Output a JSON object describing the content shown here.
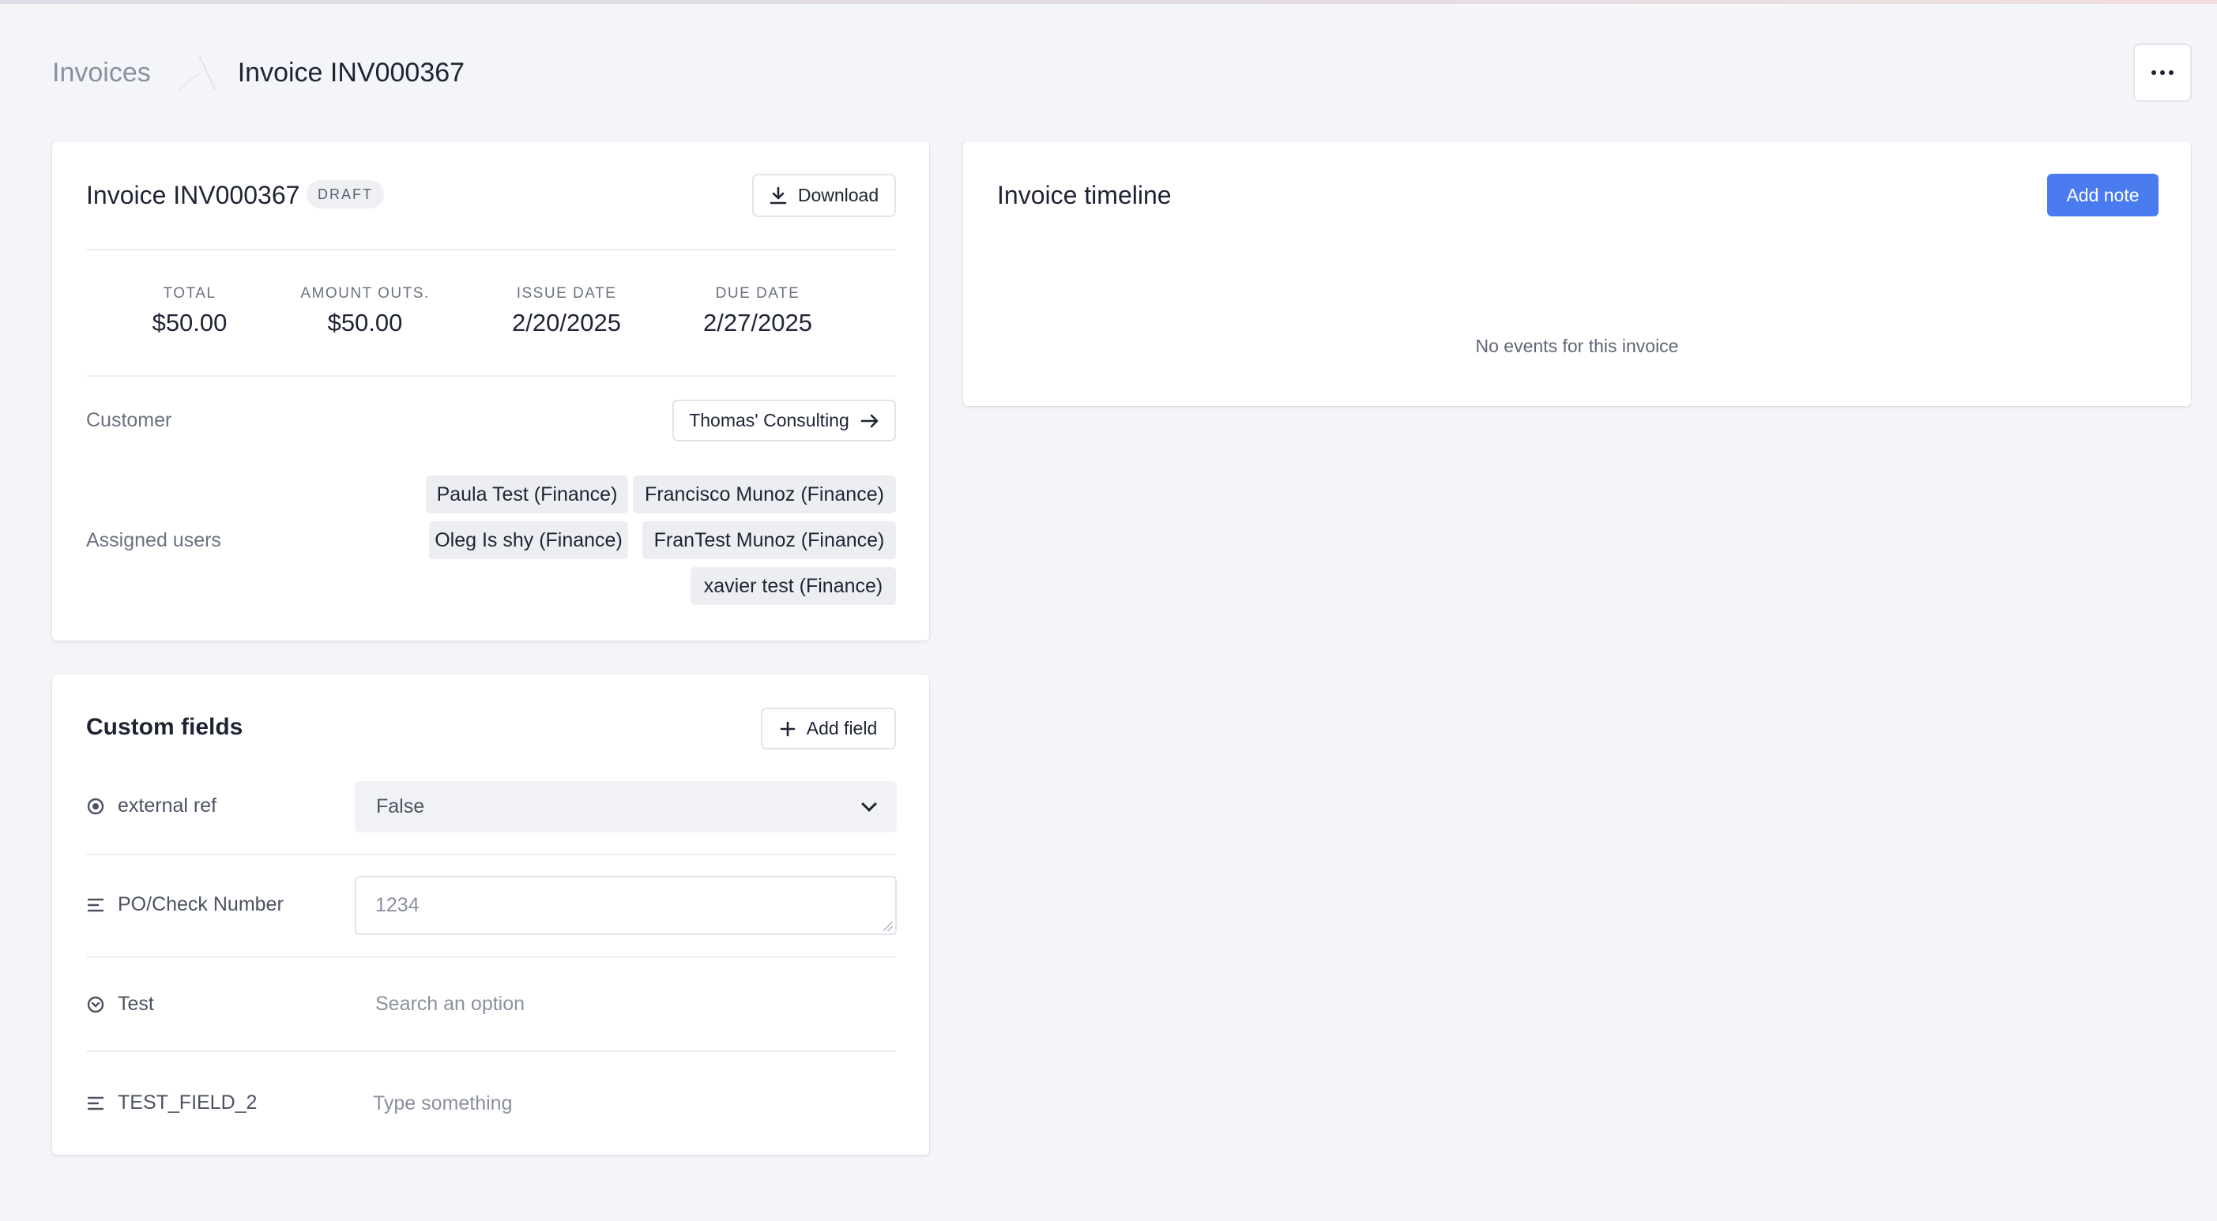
{
  "breadcrumb": {
    "parent": "Invoices",
    "current": "Invoice INV000367"
  },
  "invoice": {
    "title": "Invoice INV000367",
    "status": "DRAFT",
    "download_label": "Download",
    "stats": [
      {
        "label": "TOTAL",
        "value": "$50.00"
      },
      {
        "label": "AMOUNT OUTS.",
        "value": "$50.00"
      },
      {
        "label": "ISSUE DATE",
        "value": "2/20/2025"
      },
      {
        "label": "DUE DATE",
        "value": "2/27/2025"
      }
    ],
    "customer_label": "Customer",
    "customer_name": "Thomas' Consulting",
    "assigned_label": "Assigned users",
    "assigned_users": [
      "Paula Test (Finance)",
      "Francisco Munoz (Finance)",
      "Oleg Is shy (Finance)",
      "FranTest Munoz (Finance)",
      "xavier test (Finance)"
    ]
  },
  "timeline": {
    "title": "Invoice timeline",
    "add_note_label": "Add note",
    "empty_text": "No events for this invoice"
  },
  "custom_fields": {
    "title": "Custom fields",
    "add_field_label": "Add field",
    "fields": [
      {
        "label": "external ref",
        "value": "False",
        "icon": "radio-icon"
      },
      {
        "label": "PO/Check Number",
        "value": "1234",
        "icon": "text-lines-icon"
      },
      {
        "label": "Test",
        "placeholder": "Search an option",
        "icon": "select-icon"
      },
      {
        "label": "TEST_FIELD_2",
        "placeholder": "Type something",
        "icon": "text-lines-icon"
      }
    ]
  },
  "colors": {
    "accent": "#4a7cf0",
    "background": "#f4f5f9"
  }
}
